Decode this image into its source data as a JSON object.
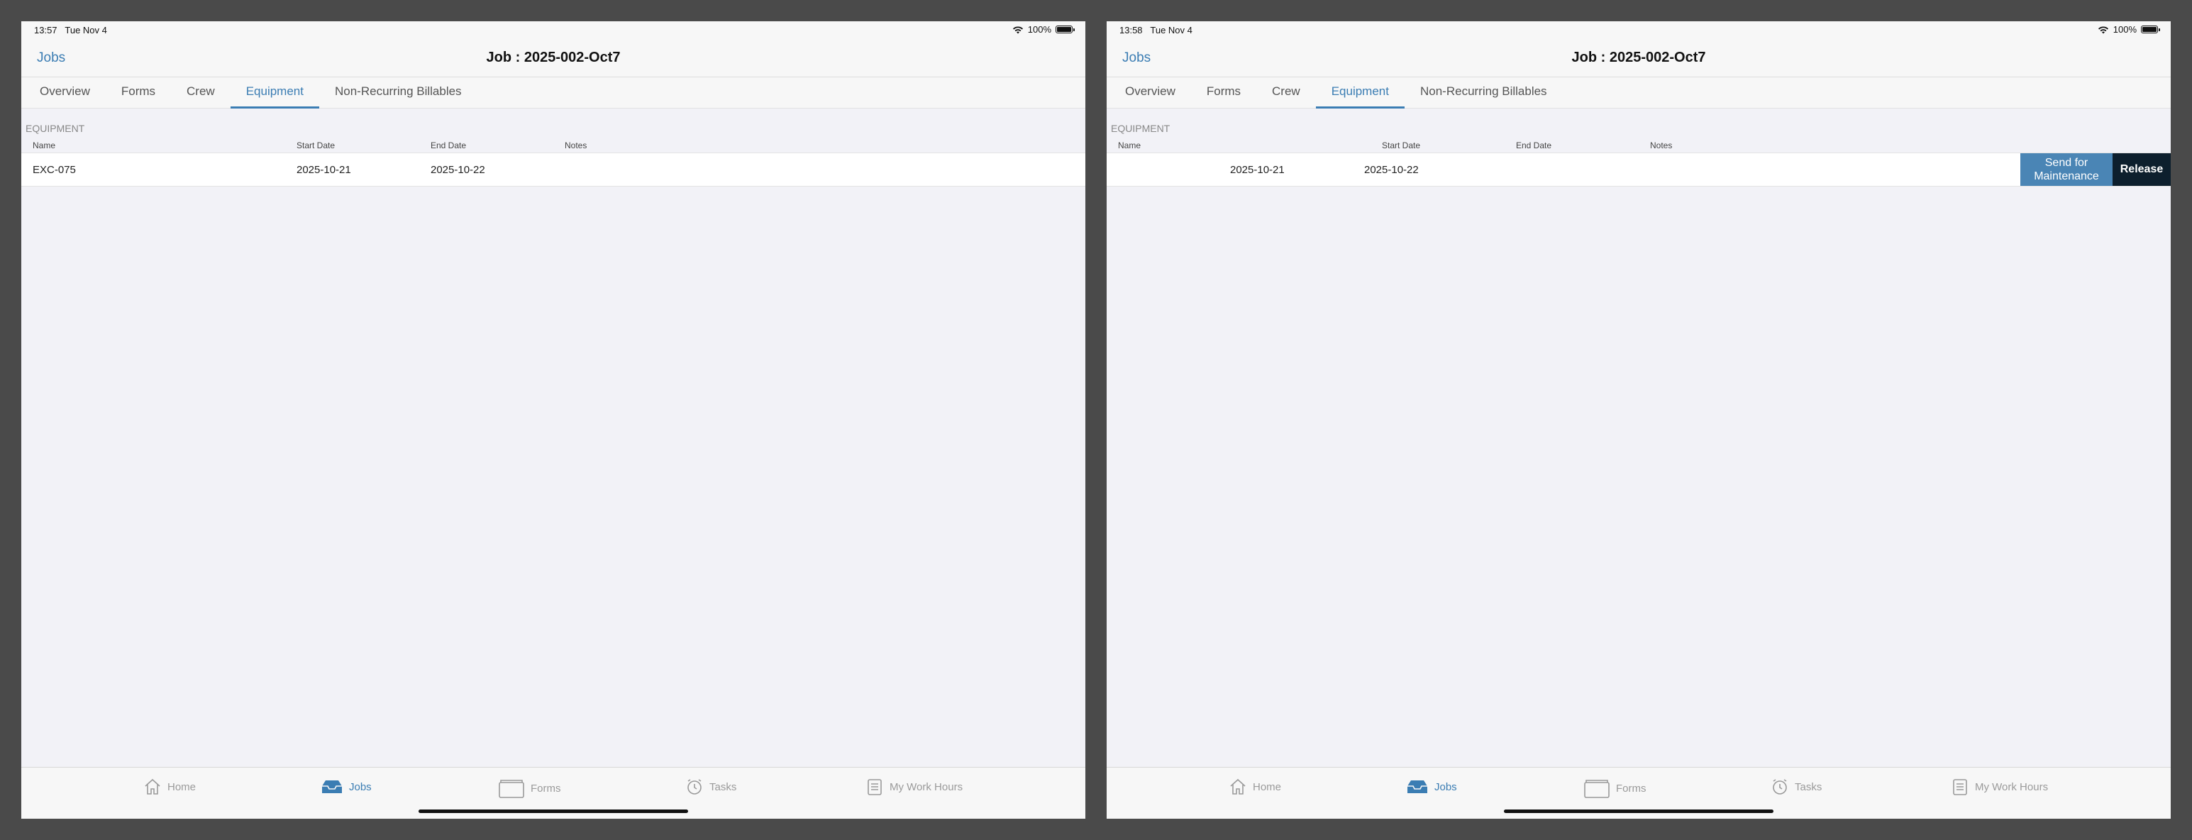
{
  "screens": [
    {
      "status": {
        "time": "13:57",
        "date": "Tue Nov 4",
        "battery": "100%"
      },
      "nav": {
        "back_label": "Jobs",
        "title": "Job : 2025-002-Oct7"
      },
      "tabs": [
        "Overview",
        "Forms",
        "Crew",
        "Equipment",
        "Non-Recurring Billables"
      ],
      "active_tab": "Equipment",
      "section": {
        "title": "EQUIPMENT",
        "columns": [
          "Name",
          "Start Date",
          "End Date",
          "Notes"
        ],
        "rows": [
          {
            "name": "EXC-075",
            "start": "2025-10-21",
            "end": "2025-10-22",
            "notes": ""
          }
        ]
      },
      "tabbar": [
        "Home",
        "Jobs",
        "Forms",
        "Tasks",
        "My Work Hours"
      ],
      "active_tabbar": "Jobs"
    },
    {
      "status": {
        "time": "13:58",
        "date": "Tue Nov 4",
        "battery": "100%"
      },
      "nav": {
        "back_label": "Jobs",
        "title": "Job : 2025-002-Oct7"
      },
      "tabs": [
        "Overview",
        "Forms",
        "Crew",
        "Equipment",
        "Non-Recurring Billables"
      ],
      "active_tab": "Equipment",
      "section": {
        "title": "EQUIPMENT",
        "columns": [
          "Name",
          "Start Date",
          "End Date",
          "Notes"
        ],
        "rows": [
          {
            "start": "2025-10-21",
            "end": "2025-10-22"
          }
        ]
      },
      "swipe_actions": {
        "maintenance_label": "Send for Maintenance",
        "release_label": "Release"
      },
      "tabbar": [
        "Home",
        "Jobs",
        "Forms",
        "Tasks",
        "My Work Hours"
      ],
      "active_tabbar": "Jobs"
    }
  ],
  "colors": {
    "accent": "#3b7db3",
    "maintenance_button": "#4a85b5",
    "release_button": "#0d1f2d"
  }
}
